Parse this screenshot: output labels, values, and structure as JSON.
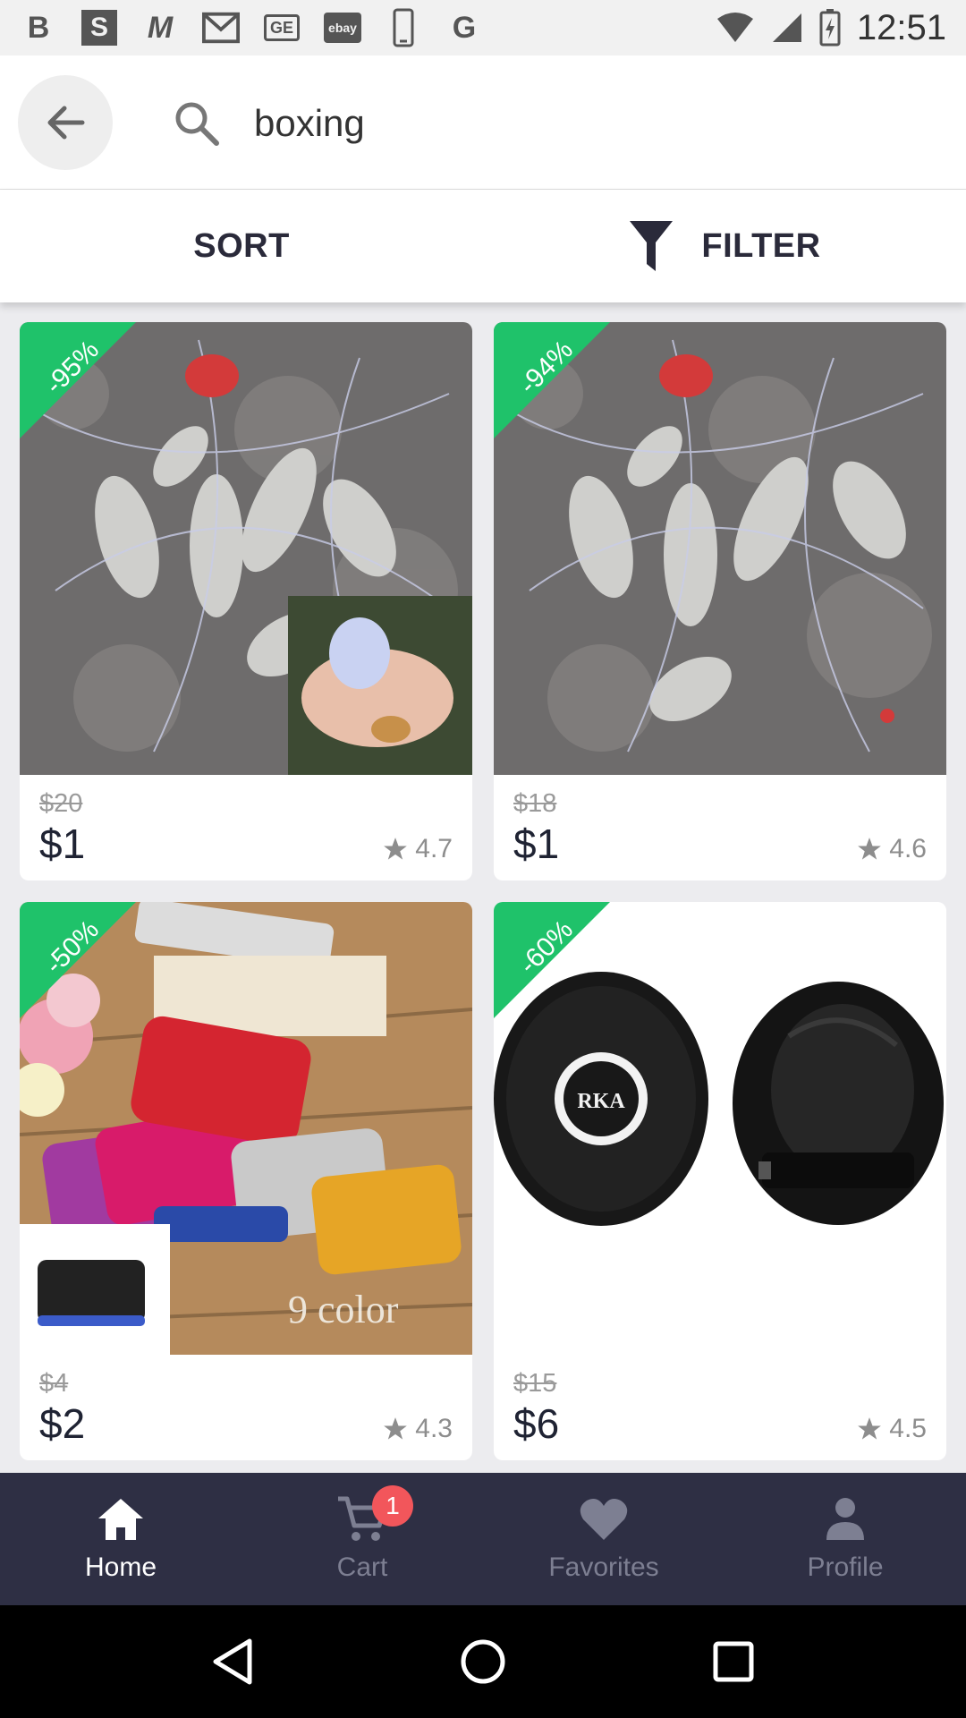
{
  "status_bar": {
    "time": "12:51",
    "notification_icons": [
      "b-icon",
      "s-icon",
      "m-icon",
      "gmail-icon",
      "ge-icon",
      "ebay-icon",
      "phone-icon",
      "google-icon"
    ]
  },
  "search": {
    "query": "boxing",
    "back_icon": "arrow-left-icon",
    "search_icon": "search-icon"
  },
  "toolbar": {
    "sort_label": "SORT",
    "filter_label": "FILTER"
  },
  "products": [
    {
      "discount": "-95%",
      "old_price": "$20",
      "price": "$1",
      "rating": "4.7",
      "image": "fishing-net-with-inset"
    },
    {
      "discount": "-94%",
      "old_price": "$18",
      "price": "$1",
      "rating": "4.6",
      "image": "fishing-net"
    },
    {
      "discount": "-50%",
      "old_price": "$4",
      "price": "$2",
      "rating": "4.3",
      "image": "card-wallets",
      "image_caption": "9 color"
    },
    {
      "discount": "-60%",
      "old_price": "$15",
      "price": "$6",
      "rating": "4.5",
      "image": "focus-mitts",
      "image_caption": "RKA"
    }
  ],
  "bottom_nav": {
    "items": [
      {
        "label": "Home",
        "icon": "home-icon",
        "active": true
      },
      {
        "label": "Cart",
        "icon": "cart-icon",
        "badge": "1"
      },
      {
        "label": "Favorites",
        "icon": "heart-icon"
      },
      {
        "label": "Profile",
        "icon": "person-icon"
      }
    ]
  },
  "colors": {
    "badge_green": "#1fc26a",
    "nav_background": "#2e2f44",
    "cart_badge": "#f2565b"
  }
}
